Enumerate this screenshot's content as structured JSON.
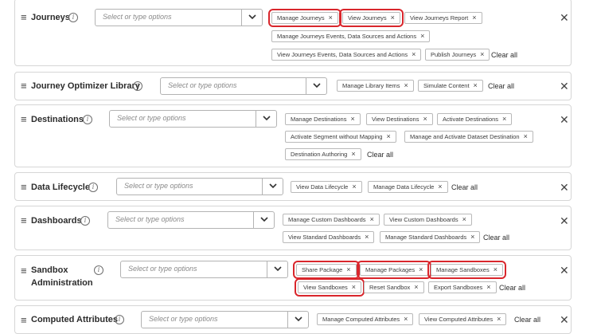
{
  "placeholder": "Select or type options",
  "clear_all": "Clear all",
  "remove_glyph": "×",
  "handle_glyph": "≡",
  "close_glyph": "✕",
  "info_glyph": "i",
  "highlight_color": "#d9262c",
  "categories": [
    {
      "title": "Journeys",
      "tags": [
        "Manage Journeys",
        "View Journeys",
        "View Journeys Report",
        "Manage Journeys Events, Data Sources and Actions",
        "View Journeys Events, Data Sources and Actions",
        "Publish Journeys"
      ],
      "highlighted": [
        "Manage Journeys",
        "View Journeys"
      ]
    },
    {
      "title": "Journey Optimizer Library",
      "tags": [
        "Manage Library Items",
        "Simulate Content"
      ],
      "highlighted": []
    },
    {
      "title": "Destinations",
      "tags": [
        "Manage Destinations",
        "View Destinations",
        "Activate Destinations",
        "Activate Segment without Mapping",
        "Manage and Activate Dataset Destination",
        "Destination Authoring"
      ],
      "highlighted": []
    },
    {
      "title": "Data Lifecycle",
      "tags": [
        "View Data Lifecycle",
        "Manage Data Lifecycle"
      ],
      "highlighted": []
    },
    {
      "title": "Dashboards",
      "tags": [
        "Manage Custom Dashboards",
        "View Custom Dashboards",
        "View Standard Dashboards",
        "Manage Standard Dashboards"
      ],
      "highlighted": []
    },
    {
      "title_line1": "Sandbox",
      "title_line2": "Administration",
      "tags": [
        "Share Package",
        "Manage Packages",
        "Manage Sandboxes",
        "View Sandboxes",
        "Reset Sandbox",
        "Export Sandboxes"
      ],
      "highlighted": [
        "Share Package",
        "Manage Packages",
        "Manage Sandboxes",
        "View Sandboxes"
      ]
    },
    {
      "title": "Computed Attributes",
      "tags": [
        "Manage Computed Attributes",
        "View Computed Attributes"
      ],
      "highlighted": []
    }
  ]
}
